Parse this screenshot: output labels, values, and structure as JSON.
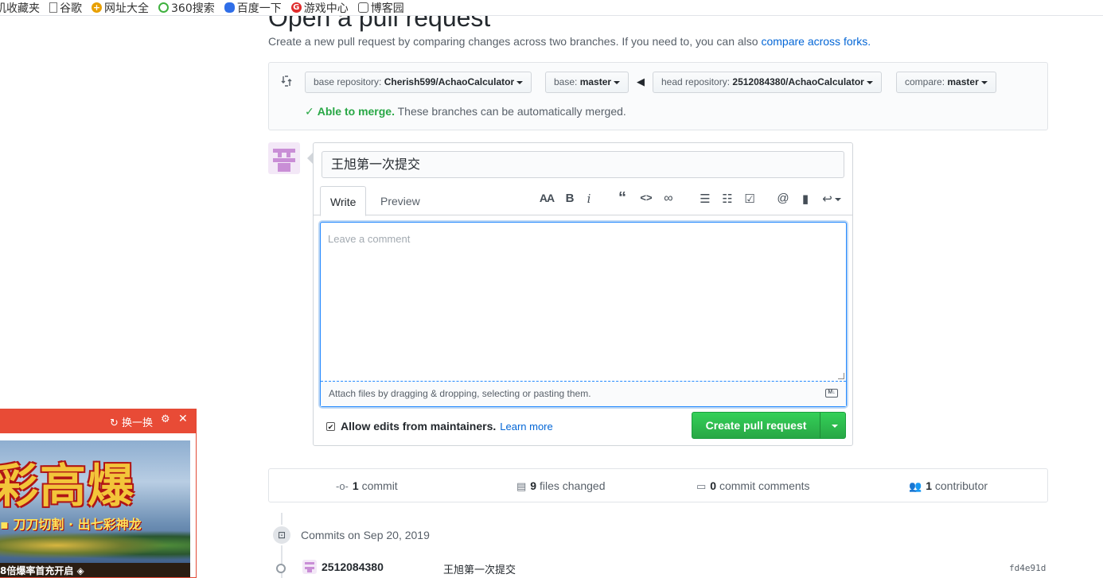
{
  "bookmarks": [
    {
      "label": "机收藏夹",
      "icon": "none"
    },
    {
      "label": "谷歌",
      "icon": "page-icon"
    },
    {
      "label": "网址大全",
      "icon": "hao123-icon"
    },
    {
      "label": "360搜索",
      "icon": "360-icon"
    },
    {
      "label": "百度一下",
      "icon": "baidu-icon"
    },
    {
      "label": "游戏中心",
      "icon": "game-center-icon"
    },
    {
      "label": "博客园",
      "icon": "cnblogs-icon"
    }
  ],
  "page": {
    "title": "Open a pull request",
    "subtitle_text": "Create a new pull request by comparing changes across two branches. If you need to, you can also",
    "subtitle_link": "compare across forks."
  },
  "compare": {
    "base_repo_label": "base repository:",
    "base_repo_value": "Cherish599/AchaoCalculator",
    "base_label": "base:",
    "base_value": "master",
    "head_repo_label": "head repository:",
    "head_repo_value": "2512084380/AchaoCalculator",
    "compare_label": "compare:",
    "compare_value": "master",
    "merge_ok": "Able to merge.",
    "merge_text": "These branches can be automatically merged."
  },
  "form": {
    "title_value": "王旭第一次提交",
    "tab_write": "Write",
    "tab_preview": "Preview",
    "toolbar": {
      "heading": "AA",
      "bold": "B",
      "italic": "i",
      "quote": "“",
      "code": "<>",
      "link": "∞",
      "ul": "☰",
      "ol": "☷",
      "tasks": "☑",
      "mention": "@",
      "bookmark": "▮",
      "reply": "↩"
    },
    "comment_placeholder": "Leave a comment",
    "attach_text": "Attach files by dragging & dropping, selecting or pasting them.",
    "md_icon": "M↓",
    "allow_bold": "Allow edits from maintainers.",
    "allow_link": "Learn more",
    "create_label": "Create pull request"
  },
  "stats": {
    "commits_count": "1",
    "commits_label": "commit",
    "files_count": "9",
    "files_label": "files changed",
    "comments_count": "0",
    "comments_label": "commit comments",
    "contributors_count": "1",
    "contributors_label": "contributor"
  },
  "commits": {
    "day_label": "Commits on Sep 20, 2019",
    "author": "2512084380",
    "message": "王旭第一次提交",
    "sha": "fd4e91d"
  },
  "ad": {
    "refresh_label": "换一换",
    "big_text": "彩高爆",
    "line_text": "▪ 刀刀切割 · 出七彩神龙",
    "bottom_text": "8倍爆率首充开启 ◈"
  },
  "colors": {
    "green": "#28a745",
    "link": "#0366d6",
    "ad_red": "#e84b36"
  }
}
